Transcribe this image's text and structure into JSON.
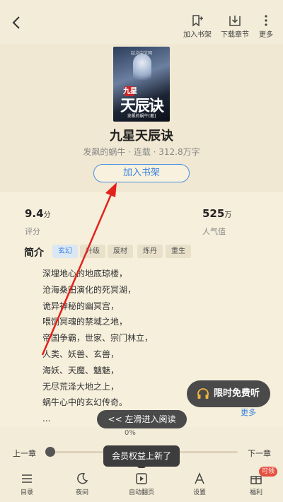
{
  "topbar": {
    "actions": [
      {
        "label": "加入书架"
      },
      {
        "label": "下载章节"
      },
      {
        "label": "更多"
      }
    ]
  },
  "book": {
    "cover": {
      "publisher": "起点中文网",
      "tag": "九星",
      "title": "天辰诀",
      "author_line": "发飙的蜗牛[著]"
    },
    "title": "九星天辰诀",
    "meta": "发飙的蜗牛 · 连载 · 312.8万字",
    "add_button": "加入书架"
  },
  "stats": {
    "score": {
      "value": "9.4",
      "unit": "分",
      "label": "评分"
    },
    "popularity": {
      "value": "525",
      "unit": "万",
      "label": "人气值"
    }
  },
  "intro": {
    "label": "简介",
    "tags": [
      "玄幻",
      "升级",
      "废材",
      "炼丹",
      "重生"
    ],
    "lines": [
      "深埋地心的地底琼楼，",
      "沧海桑田演化的死冥湖，",
      "诡异神秘的幽冥宫，",
      "喂饲冥魂的禁域之地，",
      "帝国争霸，世家、宗门林立，",
      "人类、妖兽、玄兽，",
      "海妖、天魔、魑魅，",
      "无尽荒泽大地之上，",
      "蜗牛心中的玄幻传奇。",
      "..."
    ],
    "more": "更多"
  },
  "free_listen": "限时免费听",
  "swipe_tip": "<< 左滑进入阅读",
  "progress": {
    "percent_label": "0%",
    "percent": 0,
    "prev": "上一章",
    "next": "下一章"
  },
  "toast": "会员权益上新了",
  "bottom_nav": [
    {
      "label": "目录",
      "icon": "list-icon"
    },
    {
      "label": "夜间",
      "icon": "moon-icon"
    },
    {
      "label": "自动翻页",
      "icon": "autoplay-icon"
    },
    {
      "label": "设置",
      "icon": "font-a-icon"
    },
    {
      "label": "福利",
      "icon": "gift-icon",
      "badge": "可领"
    }
  ],
  "colors": {
    "accent": "#3a82e0",
    "background": "#f6efdc",
    "annotation_arrow": "#e3221c"
  }
}
